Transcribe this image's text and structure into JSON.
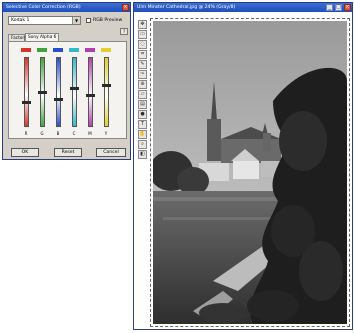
{
  "dialog": {
    "title": "Selective Color Correction (RGB)",
    "combo_value": "Kodak 1",
    "preview_label": "RGB Preview",
    "tabs": [
      {
        "label": "Factory"
      },
      {
        "label": "Sony Alpha 6"
      }
    ],
    "channels": [
      {
        "label": "R",
        "color": "#d8342a",
        "level": 0.35
      },
      {
        "label": "G",
        "color": "#3fa53a",
        "level": 0.5
      },
      {
        "label": "B",
        "color": "#2b4fd0",
        "level": 0.4
      },
      {
        "label": "C",
        "color": "#33b7c9",
        "level": 0.55
      },
      {
        "label": "M",
        "color": "#b23fb0",
        "level": 0.45
      },
      {
        "label": "Y",
        "color": "#e2cf2a",
        "level": 0.6
      }
    ],
    "buttons": {
      "ok": "OK",
      "reset": "Reset",
      "cancel": "Cancel"
    }
  },
  "image_window": {
    "title": "Ulm Minster Cathedral.jpg @ 24% (Gray/8)"
  },
  "colors": {
    "titlebar": "#2a5cc6",
    "dialog_bg": "#d4d0c8"
  }
}
